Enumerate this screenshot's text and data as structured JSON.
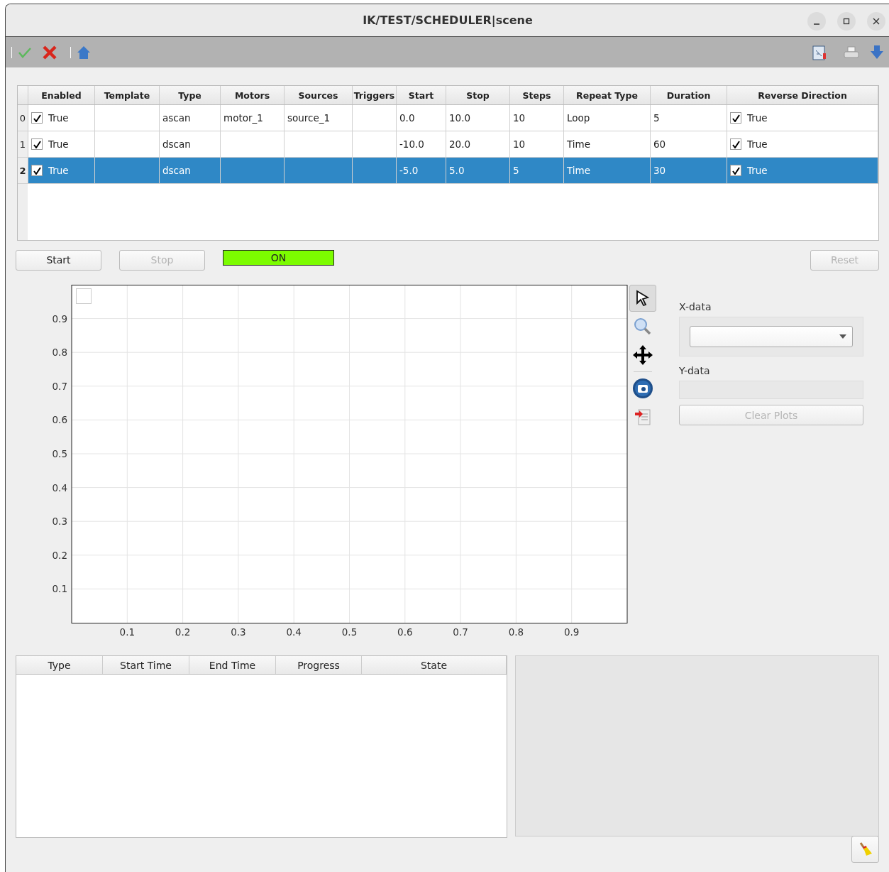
{
  "window": {
    "title": "IK/TEST/SCHEDULER|scene"
  },
  "scan_table": {
    "columns": [
      "Enabled",
      "Template",
      "Type",
      "Motors",
      "Sources",
      "Triggers",
      "Start",
      "Stop",
      "Steps",
      "Repeat Type",
      "Duration",
      "Reverse Direction"
    ],
    "rows": [
      {
        "header": "0",
        "selected": false,
        "enabled_checked": true,
        "reverse_checked": true,
        "cells": [
          "True",
          "",
          "ascan",
          "motor_1",
          "source_1",
          "",
          "0.0",
          "10.0",
          "10",
          "Loop",
          "5",
          "True"
        ]
      },
      {
        "header": "1",
        "selected": false,
        "enabled_checked": true,
        "reverse_checked": true,
        "cells": [
          "True",
          "",
          "dscan",
          "",
          "",
          "",
          "-10.0",
          "20.0",
          "10",
          "Time",
          "60",
          "True"
        ]
      },
      {
        "header": "2",
        "selected": true,
        "enabled_checked": true,
        "reverse_checked": true,
        "cells": [
          "True",
          "",
          "dscan",
          "",
          "",
          "",
          "-5.0",
          "5.0",
          "5",
          "Time",
          "30",
          "True"
        ]
      }
    ]
  },
  "controls": {
    "start": {
      "label": "Start",
      "disabled": false
    },
    "stop": {
      "label": "Stop",
      "disabled": true
    },
    "indicator": {
      "label": "ON",
      "on": true
    },
    "reset": {
      "label": "Reset",
      "disabled": true
    }
  },
  "plot": {
    "checkbox_checked": false,
    "chart_data": {
      "type": "line",
      "grid": true,
      "xlim": [
        0,
        1
      ],
      "ylim": [
        0,
        1
      ],
      "xticks": [
        0.1,
        0.2,
        0.3,
        0.4,
        0.5,
        0.6,
        0.7,
        0.8,
        0.9
      ],
      "yticks": [
        0.1,
        0.2,
        0.3,
        0.4,
        0.5,
        0.6,
        0.7,
        0.8,
        0.9
      ]
    }
  },
  "side_panel": {
    "x_label": "X-data",
    "y_label": "Y-data",
    "clear_button": {
      "label": "Clear Plots",
      "disabled": true
    }
  },
  "task_table": {
    "columns": [
      "Type",
      "Start Time",
      "End Time",
      "Progress",
      "State"
    ]
  }
}
